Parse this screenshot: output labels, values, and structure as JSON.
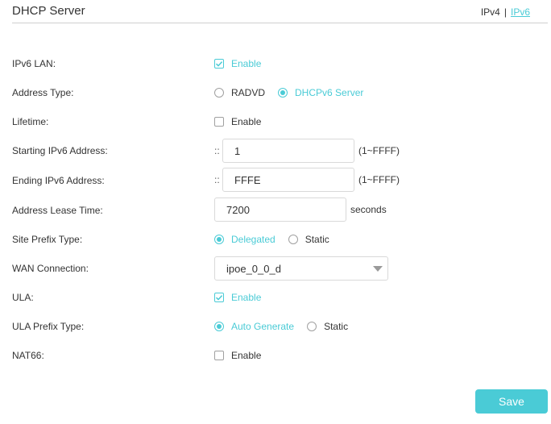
{
  "header": {
    "title": "DHCP Server",
    "ipv4": "IPv4",
    "separator": "|",
    "ipv6": "IPv6"
  },
  "colors": {
    "accent": "#4acbd6",
    "text": "#333333",
    "border": "#d9d9d9"
  },
  "fields": {
    "ipv6_lan": {
      "label": "IPv6 LAN:",
      "option": "Enable",
      "checked": true
    },
    "address_type": {
      "label": "Address Type:",
      "options": [
        "RADVD",
        "DHCPv6 Server"
      ],
      "selected": "DHCPv6 Server"
    },
    "lifetime": {
      "label": "Lifetime:",
      "option": "Enable",
      "checked": false
    },
    "start_addr": {
      "label": "Starting IPv6 Address:",
      "prefix": "::",
      "value": "1",
      "range": "(1~FFFF)"
    },
    "end_addr": {
      "label": "Ending IPv6 Address:",
      "prefix": "::",
      "value": "FFFE",
      "range": "(1~FFFF)"
    },
    "lease_time": {
      "label": "Address Lease Time:",
      "value": "7200",
      "unit": "seconds"
    },
    "site_prefix": {
      "label": "Site Prefix Type:",
      "options": [
        "Delegated",
        "Static"
      ],
      "selected": "Delegated"
    },
    "wan": {
      "label": "WAN Connection:",
      "value": "ipoe_0_0_d"
    },
    "ula": {
      "label": "ULA:",
      "option": "Enable",
      "checked": true
    },
    "ula_prefix": {
      "label": "ULA Prefix Type:",
      "options": [
        "Auto Generate",
        "Static"
      ],
      "selected": "Auto Generate"
    },
    "nat66": {
      "label": "NAT66:",
      "option": "Enable",
      "checked": false
    }
  },
  "save_label": "Save"
}
